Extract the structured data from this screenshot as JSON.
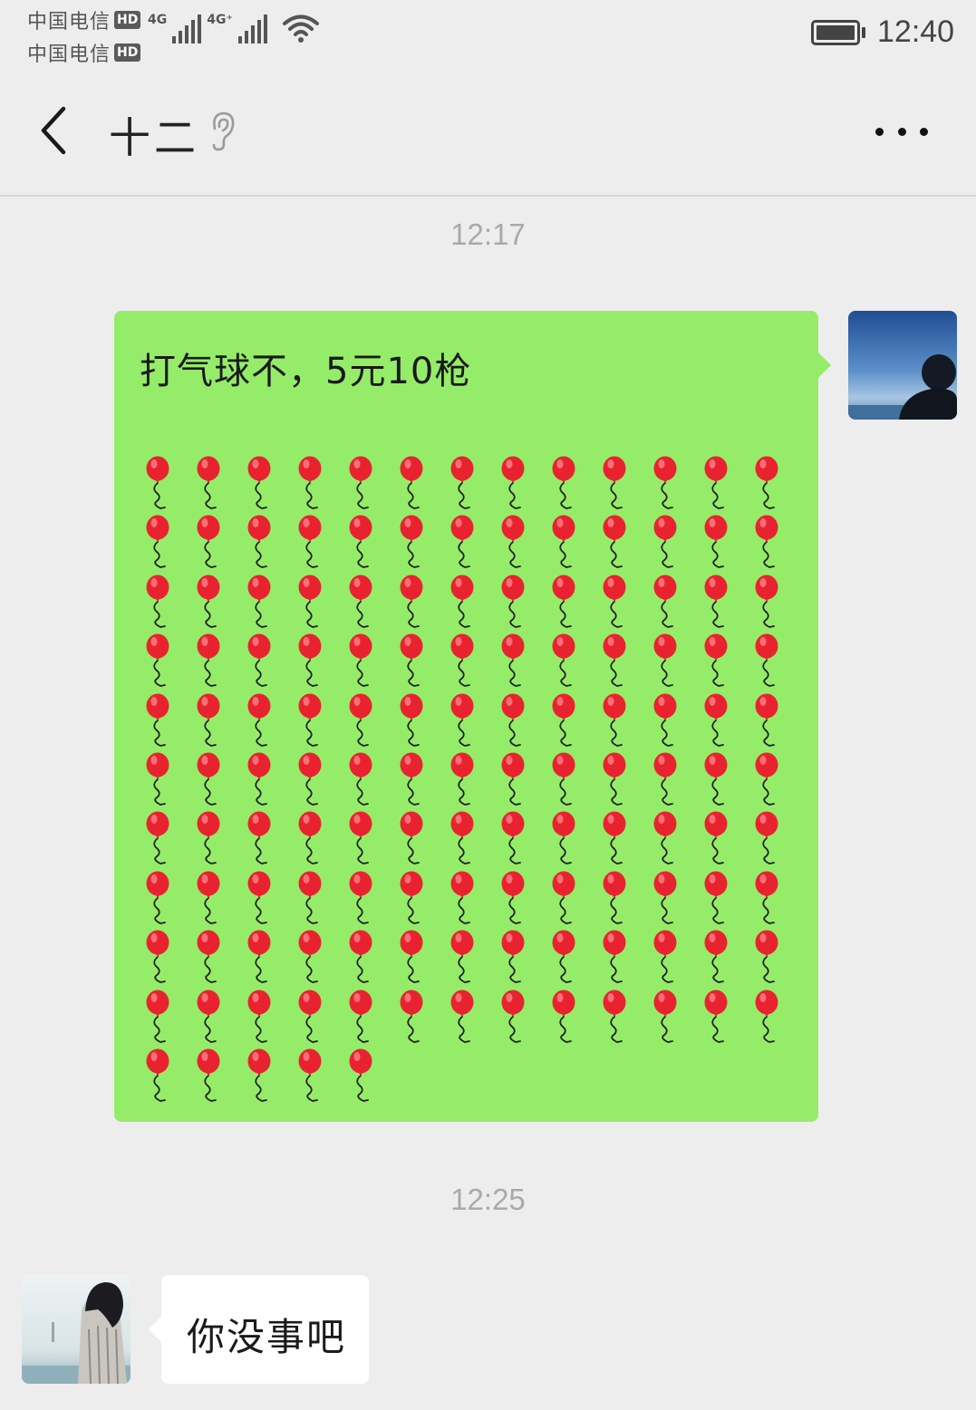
{
  "status_bar": {
    "carriers": [
      {
        "name": "中国电信",
        "badge": "HD"
      },
      {
        "name": "中国电信",
        "badge": "HD"
      }
    ],
    "networks": [
      "4G",
      "4G⁺"
    ],
    "icons": [
      "signal-icon",
      "signal-icon",
      "wifi-icon",
      "battery-icon"
    ],
    "time": "12:40"
  },
  "header": {
    "title": "十二",
    "icons": [
      "back-arrow-icon",
      "ear-icon",
      "more-icon"
    ]
  },
  "messages": [
    {
      "type": "timestamp",
      "text": "12:17"
    },
    {
      "type": "outgoing",
      "text": "打气球不，5元10枪",
      "emoji": "balloon",
      "emoji_count": 135,
      "emoji_per_row": 13
    },
    {
      "type": "timestamp",
      "text": "12:25"
    },
    {
      "type": "incoming",
      "text": "你没事吧"
    }
  ],
  "colors": {
    "background": "#ededed",
    "outgoing_bubble": "#95ec69",
    "incoming_bubble": "#ffffff",
    "timestamp_text": "#a9a9a9",
    "balloon": "#e8232f"
  }
}
